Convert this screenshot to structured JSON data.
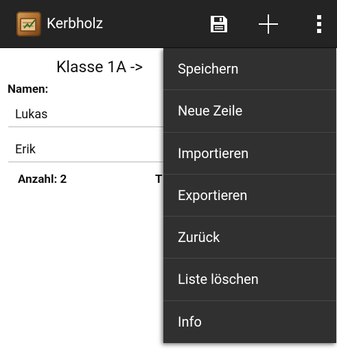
{
  "app": {
    "title": "Kerbholz"
  },
  "action_bar": {
    "icons": {
      "app": "app-logo-icon",
      "save": "floppy-disk-icon",
      "add": "plus-icon",
      "overflow": "overflow-menu-icon"
    }
  },
  "content": {
    "title": "Klasse 1A ->",
    "names_label": "Namen:",
    "names": [
      "Lukas",
      "Erik"
    ],
    "count_label": "Anzahl: 2",
    "clipped_label": "T"
  },
  "menu": {
    "items": [
      "Speichern",
      "Neue Zeile",
      "Importieren",
      "Exportieren",
      "Zurück",
      "Liste löschen",
      "Info"
    ]
  },
  "colors": {
    "action_bar": "#242424",
    "menu_bg": "#303030",
    "menu_divider": "#474747",
    "text_light": "#ffffff"
  }
}
